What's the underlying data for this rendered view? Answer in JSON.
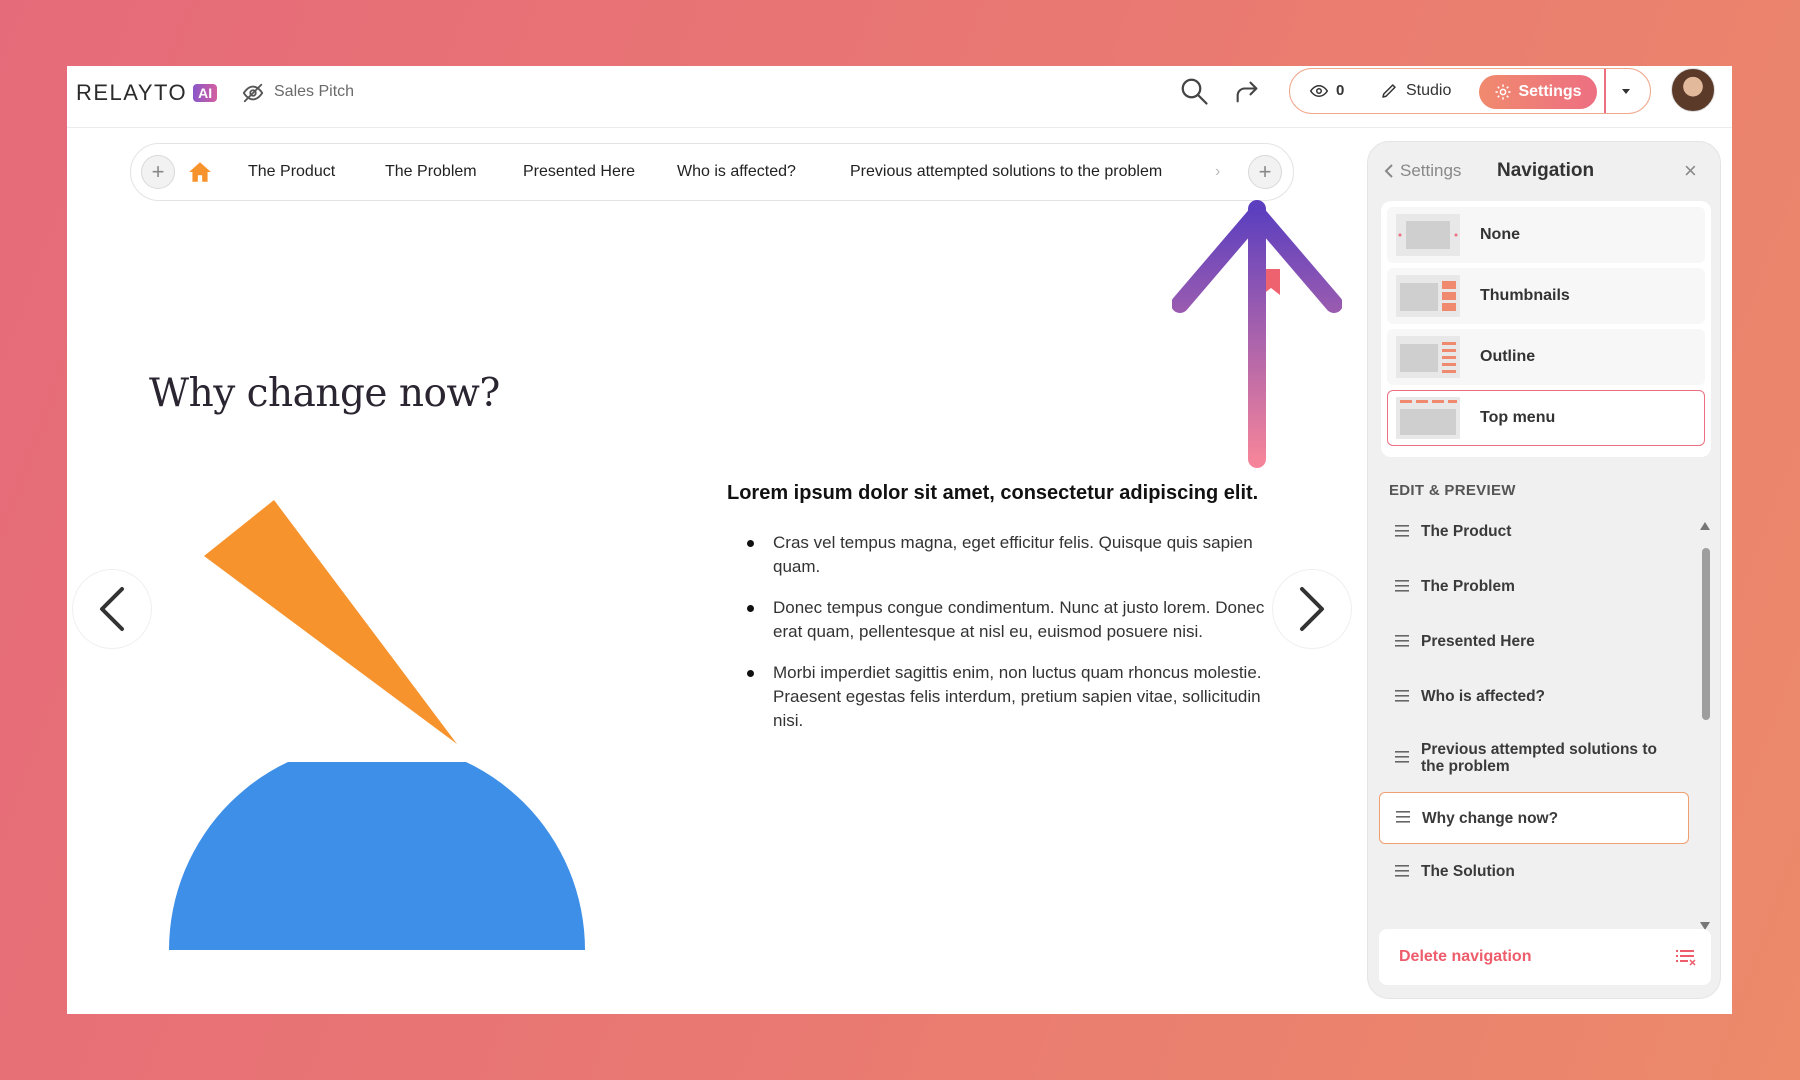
{
  "app": {
    "logo_text": "RELAYTO",
    "logo_badge": "AI",
    "doc_name": "Sales Pitch",
    "view_count": "0",
    "studio_label": "Studio",
    "settings_label": "Settings"
  },
  "topnav": {
    "items": [
      {
        "label": "The Product"
      },
      {
        "label": "The Problem"
      },
      {
        "label": "Presented Here"
      },
      {
        "label": "Who is affected?"
      },
      {
        "label": "Previous attempted solutions to the problem"
      }
    ]
  },
  "slide": {
    "title": "Why change now?",
    "heading": "Lorem ipsum dolor sit amet, consectetur adipiscing elit.",
    "bullets": [
      "Cras vel tempus magna, eget efficitur felis. Quisque quis sapien quam.",
      "Donec tempus congue condimentum. Nunc at justo lorem. Donec erat quam, pellentesque at nisl eu, euismod posuere nisi.",
      "Morbi imperdiet sagittis enim, non luctus quam rhoncus molestie. Praesent egestas felis interdum, pretium sapien vitae, sollicitudin nisi."
    ],
    "colors": {
      "triangle": "#f7932d",
      "semicircle": "#3d8fe8"
    }
  },
  "panel": {
    "back_label": "Settings",
    "title": "Navigation",
    "options": [
      {
        "label": "None"
      },
      {
        "label": "Thumbnails"
      },
      {
        "label": "Outline"
      },
      {
        "label": "Top menu",
        "selected": true
      }
    ],
    "section_label": "EDIT & PREVIEW",
    "items": [
      {
        "label": "The Product"
      },
      {
        "label": "The Problem"
      },
      {
        "label": "Presented Here"
      },
      {
        "label": "Who is affected?"
      },
      {
        "label": "Previous attempted solutions to the problem"
      },
      {
        "label": "Why change now?",
        "active": true
      },
      {
        "label": "The Solution"
      }
    ],
    "delete_label": "Delete navigation"
  },
  "colors": {
    "accent": "#ed6f82",
    "accent_orange": "#f08a6e",
    "arrow_top": "#5b3fbf",
    "arrow_bottom": "#f4849a"
  }
}
